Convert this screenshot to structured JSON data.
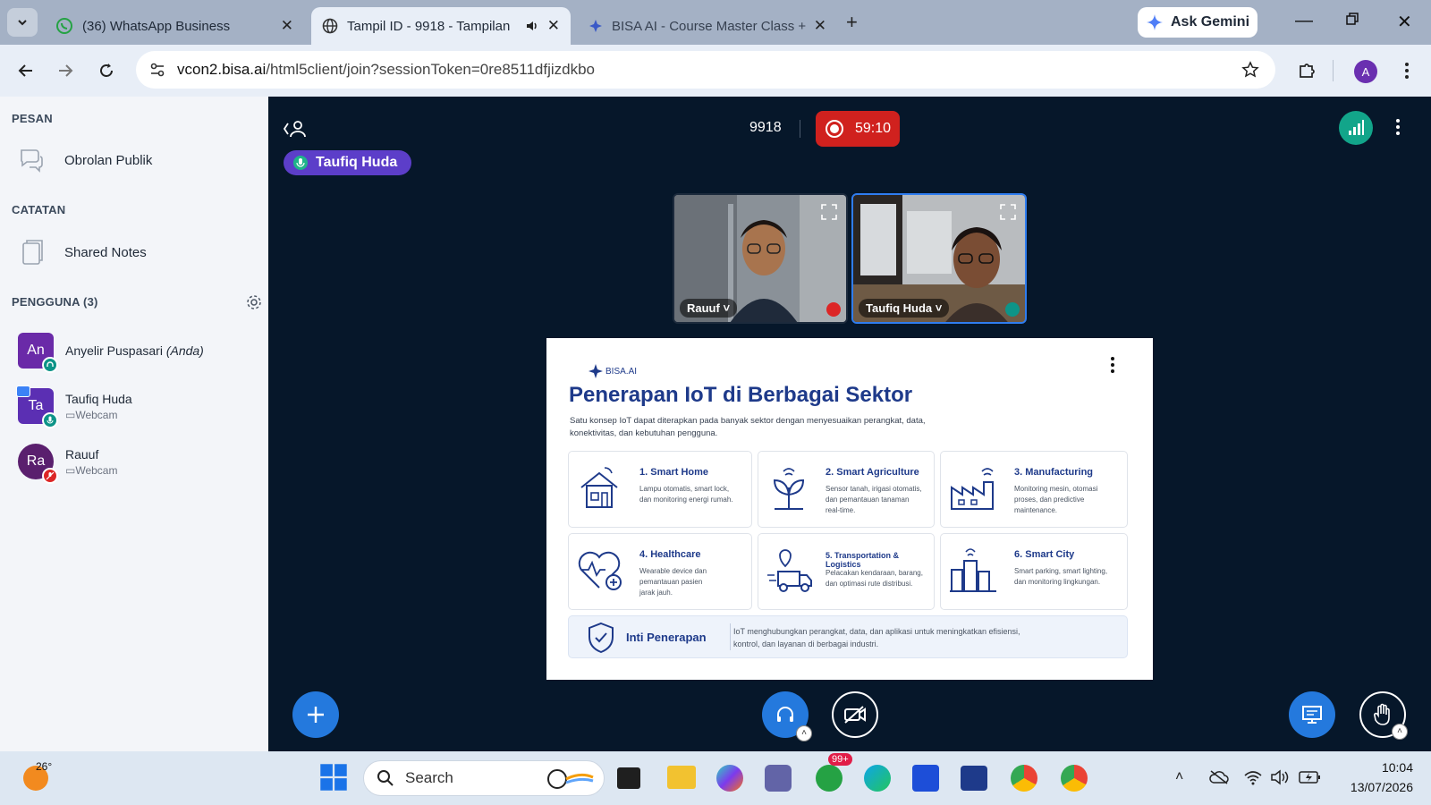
{
  "browser": {
    "tabs": [
      {
        "title": "(36) WhatsApp Business"
      },
      {
        "title": "Tampil ID - 9918 - Tampilan"
      },
      {
        "title": "BISA AI - Course Master Class +"
      }
    ],
    "ask_gemini": "Ask Gemini",
    "url_host": "vcon2.bisa.ai",
    "url_path": "/html5client/join?sessionToken=0re8511dfjizdkbo",
    "profile_initial": "A"
  },
  "sidebar": {
    "messages_header": "PESAN",
    "public_chat": "Obrolan Publik",
    "notes_header": "CATATAN",
    "shared_notes": "Shared Notes",
    "users_header": "PENGGUNA (3)",
    "users": [
      {
        "initials": "An",
        "name": "Anyelir Puspasari",
        "suffix": "(Anda)",
        "color": "#6a2aa8"
      },
      {
        "initials": "Ta",
        "name": "Taufiq Huda",
        "sub": "Webcam",
        "color": "#5b2fb3"
      },
      {
        "initials": "Ra",
        "name": "Rauuf",
        "sub": "Webcam",
        "color": "#5a1f6e"
      }
    ]
  },
  "meeting": {
    "id": "9918",
    "timer": "59:10",
    "talking": "Taufiq Huda",
    "videos": [
      {
        "name": "Rauuf"
      },
      {
        "name": "Taufiq Huda"
      }
    ]
  },
  "slide": {
    "logo": "BISA.AI",
    "title": "Penerapan IoT di Berbagai Sektor",
    "subtitle_line1": "Satu konsep IoT dapat diterapkan pada banyak sektor dengan menyesuaikan perangkat, data,",
    "subtitle_line2": "konektivitas, dan kebutuhan pengguna.",
    "cards": [
      {
        "title": "1. Smart Home",
        "desc1": "Lampu otomatis, smart lock,",
        "desc2": "dan monitoring energi rumah.",
        "desc3": ""
      },
      {
        "title": "2. Smart Agriculture",
        "desc1": "Sensor tanah, irigasi otomatis,",
        "desc2": "dan pemantauan tanaman",
        "desc3": "real-time."
      },
      {
        "title": "3. Manufacturing",
        "desc1": "Monitoring mesin, otomasi",
        "desc2": "proses, dan predictive",
        "desc3": "maintenance."
      },
      {
        "title": "4. Healthcare",
        "desc1": "Wearable device dan",
        "desc2": "pemantauan pasien",
        "desc3": "jarak jauh."
      },
      {
        "title": "5. Transportation & Logistics",
        "desc1": "Pelacakan kendaraan, barang,",
        "desc2": "dan optimasi rute distribusi.",
        "desc3": ""
      },
      {
        "title": "6. Smart City",
        "desc1": "Smart parking, smart lighting,",
        "desc2": "dan monitoring lingkungan.",
        "desc3": ""
      }
    ],
    "core_title": "Inti Penerapan",
    "core_line1": "IoT menghubungkan perangkat, data, dan aplikasi untuk meningkatkan efisiensi,",
    "core_line2": "kontrol, dan layanan di berbagai industri."
  },
  "taskbar": {
    "weather_temp": "26°",
    "search_placeholder": "Search",
    "whatsapp_badge": "99+",
    "time": "10:04",
    "date": "13/07/2026"
  }
}
